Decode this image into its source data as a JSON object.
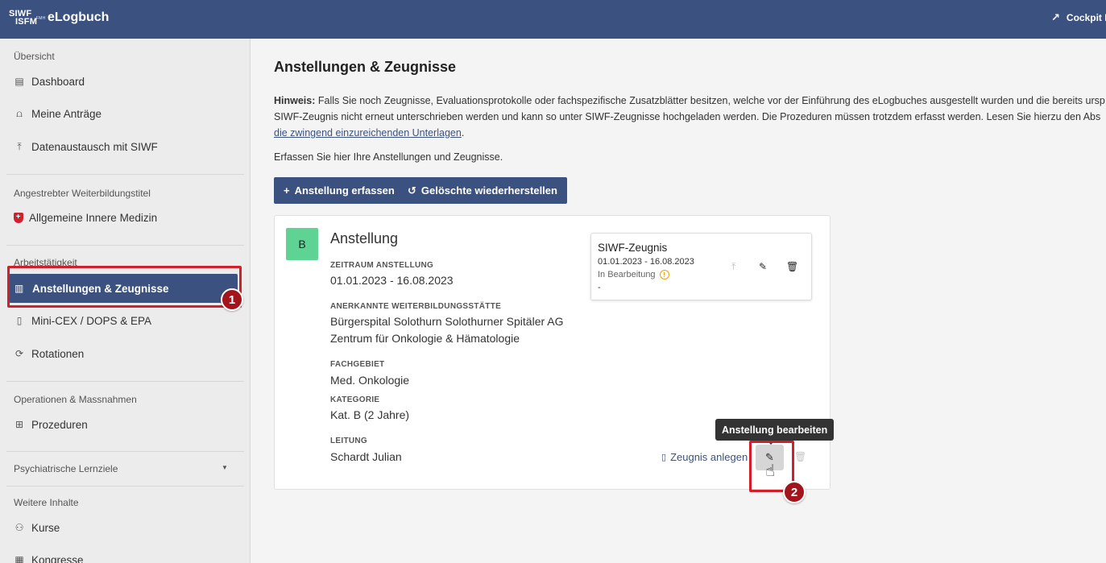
{
  "header": {
    "logo_line1": "SIWF",
    "logo_line2": "ISFM",
    "logo_mini": "FMH",
    "app_name": "eLogbuch",
    "cockpit_label": "Cockpit F"
  },
  "sidebar": {
    "sections": [
      {
        "title": "Übersicht"
      },
      {
        "title": "Angestrebter Weiterbildungstitel"
      },
      {
        "title": "Arbeitstätigkeit"
      },
      {
        "title": "Operationen & Massnahmen"
      },
      {
        "title": "Psychiatrische Lernziele"
      },
      {
        "title": "Weitere Inhalte"
      }
    ],
    "items": {
      "dashboard": "Dashboard",
      "antraege": "Meine Anträge",
      "datenaustausch": "Datenaustausch mit SIWF",
      "weiterbildungstitel": "Allgemeine Innere Medizin",
      "anstellungen": "Anstellungen & Zeugnisse",
      "minicex": "Mini-CEX / DOPS & EPA",
      "rotationen": "Rotationen",
      "prozeduren": "Prozeduren",
      "kurse": "Kurse",
      "kongresse": "Kongresse"
    },
    "badge": "1"
  },
  "main": {
    "title": "Anstellungen & Zeugnisse",
    "hint_bold": "Hinweis:",
    "hint_line1": " Falls Sie noch Zeugnisse, Evaluationsprotokolle oder fachspezifische Zusatzblätter besitzen, welche vor der Einführung des eLogbuches ausgestellt wurden und die bereits ursp",
    "hint_line2": "SIWF-Zeugnis nicht erneut unterschrieben werden und kann so unter SIWF-Zeugnisse hochgeladen werden. Die Prozeduren müssen trotzdem erfasst werden. Lesen Sie hierzu den Abs",
    "hint_link": "die zwingend einzureichenden Unterlagen",
    "hint_end": ".",
    "intro": "Erfassen Sie hier Ihre Anstellungen und Zeugnisse.",
    "btn_add": "Anstellung erfassen",
    "btn_restore": "Gelöschte wiederherstellen"
  },
  "card": {
    "category_letter": "B",
    "title": "Anstellung",
    "zeitraum_label": "ZEITRAUM ANSTELLUNG",
    "zeitraum_value": "01.01.2023 - 16.08.2023",
    "staette_label": "ANERKANNTE WEITERBILDUNGSSTÄTTE",
    "staette_line1": "Bürgerspital Solothurn Solothurner Spitäler AG",
    "staette_line2": "Zentrum für Onkologie & Hämatologie",
    "fachgebiet_label": "FACHGEBIET",
    "fachgebiet_value": "Med. Onkologie",
    "kategorie_label": "KATEGORIE",
    "kategorie_value": "Kat. B (2 Jahre)",
    "leitung_label": "LEITUNG",
    "leitung_value": "Schardt Julian",
    "zeugnis_link": "Zeugnis anlegen",
    "tooltip": "Anstellung bearbeiten",
    "badge": "2"
  },
  "document": {
    "title": "SIWF-Zeugnis",
    "date": "01.01.2023 - 16.08.2023",
    "status": "In Bearbeitung",
    "dash": "-"
  },
  "colors": {
    "header_bg": "#3b5281",
    "accent": "#3b5281",
    "highlight": "#d31f2a",
    "badge_bg": "#a3151c",
    "category_green": "#5fd393",
    "warning": "#f0a000"
  },
  "icons": {
    "cockpit": "arrow-up-right-icon",
    "dashboard": "dashboard-icon",
    "antraege": "user-stack-icon",
    "datenaustausch": "upload-icon",
    "weiterbildungstitel": "swiss-shield-icon",
    "anstellungen": "building-icon",
    "minicex": "bookmark-icon",
    "rotationen": "rotate-icon",
    "prozeduren": "plus-square-icon",
    "kurse": "people-icon",
    "kongresse": "calendar-icon"
  }
}
